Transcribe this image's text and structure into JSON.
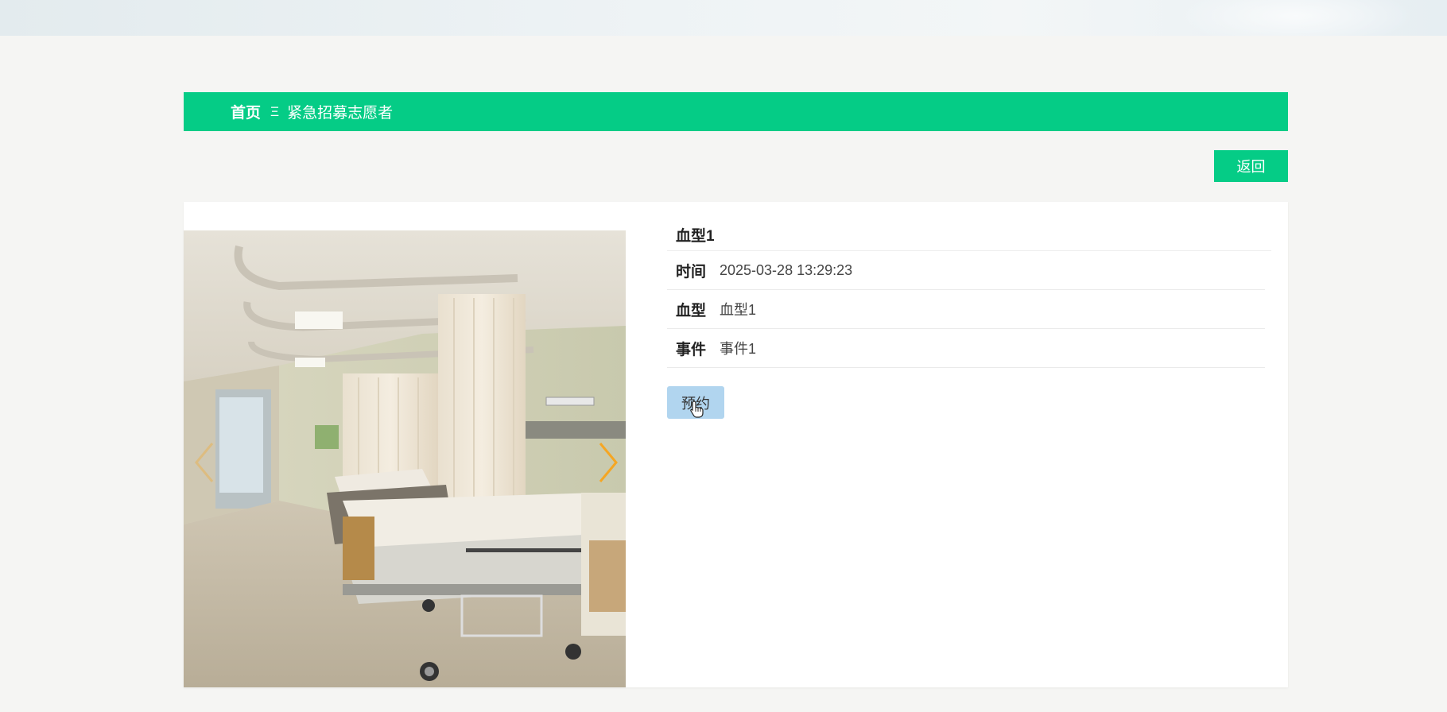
{
  "breadcrumb": {
    "home": "首页",
    "separator": "Ξ",
    "current": "紧急招募志愿者"
  },
  "actions": {
    "back_label": "返回"
  },
  "detail": {
    "title": "血型1",
    "rows": [
      {
        "label": "时间",
        "value": "2025-03-28 13:29:23"
      },
      {
        "label": "血型",
        "value": "血型1"
      },
      {
        "label": "事件",
        "value": "事件1"
      }
    ],
    "reserve_label": "预约"
  },
  "colors": {
    "accent": "#05cc86",
    "reserve_button": "#b1d5ef",
    "carousel_arrow": "#f5a623"
  },
  "icons": {
    "prev": "chevron-left-icon",
    "next": "chevron-right-icon",
    "cursor": "hand-pointer-icon"
  }
}
